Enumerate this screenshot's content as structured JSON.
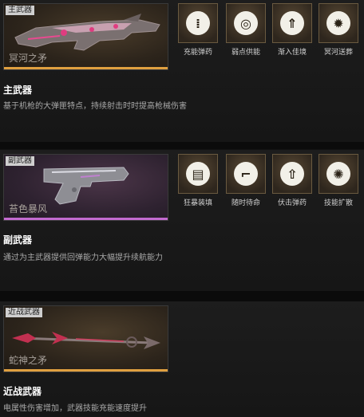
{
  "primary": {
    "tag": "主武器",
    "weapon_name": "冥河之矛",
    "title": "主武器",
    "description": "基于机枪的大弹匣特点，持续射击时时提高枪械伤害",
    "skills": [
      {
        "label": "充能弹药",
        "icon": "ammo-icon",
        "glyph": "⁞"
      },
      {
        "label": "弱点供能",
        "icon": "target-icon",
        "glyph": "◎"
      },
      {
        "label": "渐入佳境",
        "icon": "rising-shield-icon",
        "glyph": "⇑"
      },
      {
        "label": "冥河送葬",
        "icon": "vortex-icon",
        "glyph": "✹"
      }
    ]
  },
  "secondary": {
    "tag": "副武器",
    "weapon_name": "苔色暴风",
    "title": "副武器",
    "description": "通过为主武器提供回弹能力大幅提升续航能力",
    "skills": [
      {
        "label": "狂暴装填",
        "icon": "magazine-icon",
        "glyph": "▤"
      },
      {
        "label": "随时待命",
        "icon": "pistol-icon",
        "glyph": "⌐"
      },
      {
        "label": "伏击弹药",
        "icon": "arrow-up-icon",
        "glyph": "⇧"
      },
      {
        "label": "技能扩散",
        "icon": "burst-icon",
        "glyph": "✺"
      }
    ]
  },
  "melee": {
    "tag": "近战武器",
    "weapon_name": "蛇神之矛",
    "title": "近战武器",
    "description": "电属性伤害增加，武器技能充能速度提升"
  }
}
